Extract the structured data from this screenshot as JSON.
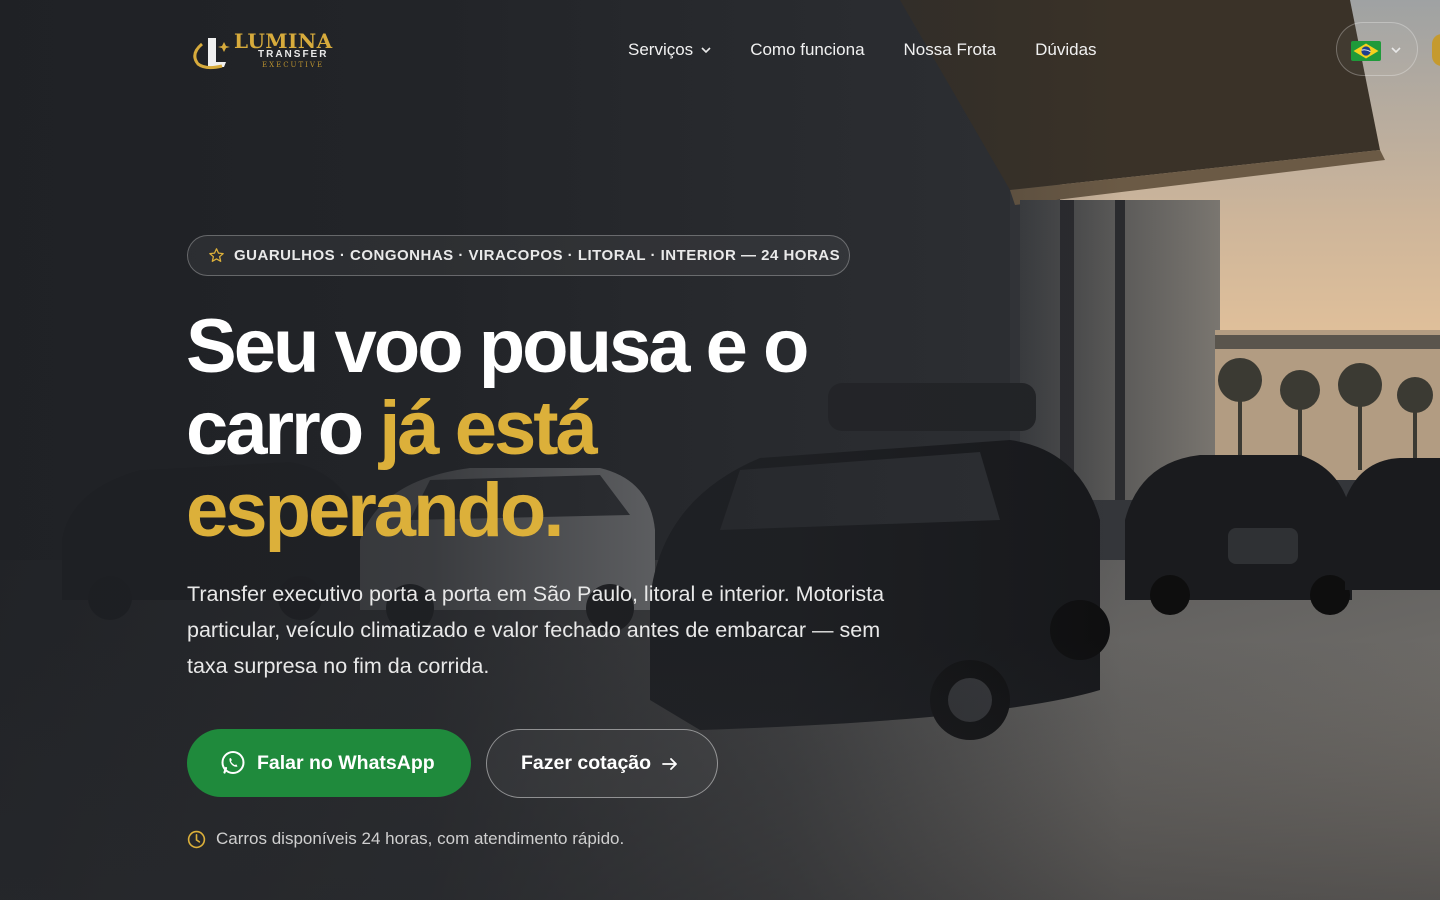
{
  "brand": {
    "name": "LUMINA",
    "sub": "TRANSFER",
    "tagline": "EXECUTIVE",
    "gold": "#d7ab3c"
  },
  "nav": {
    "items": [
      {
        "label": "Serviços",
        "has_dropdown": true
      },
      {
        "label": "Como funciona",
        "has_dropdown": false
      },
      {
        "label": "Nossa Frota",
        "has_dropdown": false
      },
      {
        "label": "Dúvidas",
        "has_dropdown": false
      }
    ]
  },
  "language": {
    "flag": "brazil-flag-icon",
    "has_dropdown": true
  },
  "hero": {
    "badge_icon": "star-icon",
    "badge": "GUARULHOS · CONGONHAS · VIRACOPOS · LITORAL · INTERIOR — 24 HORAS",
    "headline_white": "Seu voo pousa e o carro ",
    "headline_gold": "já está esperando.",
    "lead": "Transfer executivo porta a porta em São Paulo, litoral e interior. Motorista particular, veículo climatizado e valor fechado antes de embarcar — sem taxa surpresa no fim da corrida.",
    "cta_whatsapp": "Falar no WhatsApp",
    "cta_quote": "Fazer cotação",
    "availability_icon": "clock-icon",
    "availability": "Carros disponíveis 24 horas, com atendimento rápido."
  },
  "colors": {
    "accent": "#dcb03a",
    "whatsapp_green": "#1f8a3c",
    "background": "#2f3135"
  }
}
